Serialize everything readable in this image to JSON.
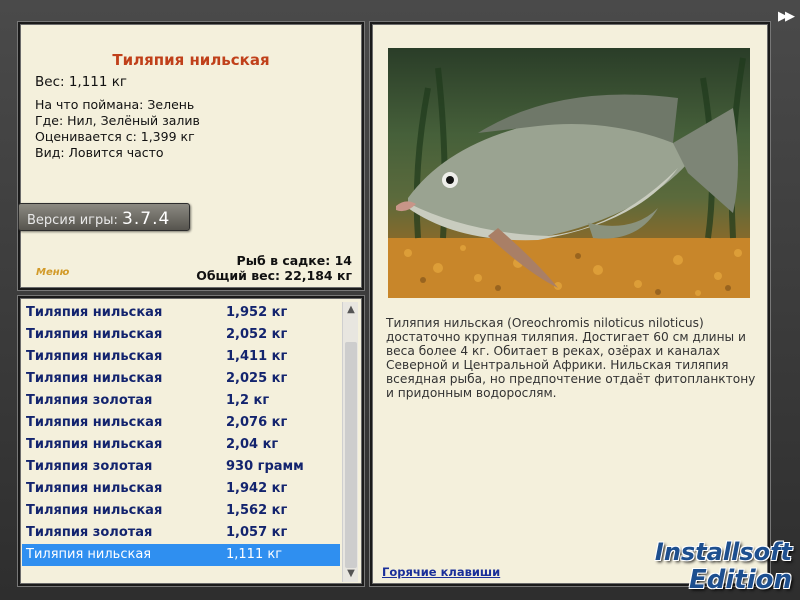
{
  "info": {
    "title": "Тиляпия нильская",
    "weight": "Вес: 1,111 кг",
    "details": [
      "На что поймана: Зелень",
      "Где: Нил, Зелёный залив",
      "Оценивается с: 1,399 кг",
      "Вид: Ловится часто"
    ],
    "version_label": "Версия игры:",
    "version_number": "3.7.4",
    "menu_label": "Меню",
    "fish_count": "Рыб в садке: 14",
    "total_weight": "Общий вес: 22,184 кг"
  },
  "catch_list": [
    {
      "name": "Тиляпия нильская",
      "weight": "1,952 кг"
    },
    {
      "name": "Тиляпия нильская",
      "weight": "2,052 кг"
    },
    {
      "name": "Тиляпия нильская",
      "weight": "1,411 кг"
    },
    {
      "name": "Тиляпия нильская",
      "weight": "2,025 кг"
    },
    {
      "name": "Тиляпия золотая",
      "weight": "1,2 кг"
    },
    {
      "name": "Тиляпия нильская",
      "weight": "2,076 кг"
    },
    {
      "name": "Тиляпия нильская",
      "weight": "2,04 кг"
    },
    {
      "name": "Тиляпия золотая",
      "weight": "930 грамм"
    },
    {
      "name": "Тиляпия нильская",
      "weight": "1,942 кг"
    },
    {
      "name": "Тиляпия нильская",
      "weight": "1,562 кг"
    },
    {
      "name": "Тиляпия золотая",
      "weight": "1,057 кг"
    },
    {
      "name": "Тиляпия нильская",
      "weight": "1,111 кг"
    }
  ],
  "selected_index": 11,
  "description": "Тиляпия нильская (Oreochromis niloticus niloticus) достаточно крупная тиляпия. Достигает 60 см длины и веса более 4 кг. Обитает в реках, озёрах и каналах Северной и Центральной Африки. Нильская тиляпия всеядная рыба, но предпочтение отдаёт фитопланктону и придонным водорослям.",
  "hotkeys_label": "Горячие клавиши",
  "skip_icon": "double-arrow-icon",
  "scroll_icons": {
    "up": "chevron-up-icon",
    "down": "chevron-down-icon"
  },
  "watermark": {
    "line1": "Installsoft",
    "line2": "Edition"
  },
  "colors": {
    "title": "#c0401a",
    "list_text": "#13246e",
    "selection": "#2f8ff0",
    "panel_bg": "#f4f0dc",
    "link": "#1a2f9a"
  }
}
